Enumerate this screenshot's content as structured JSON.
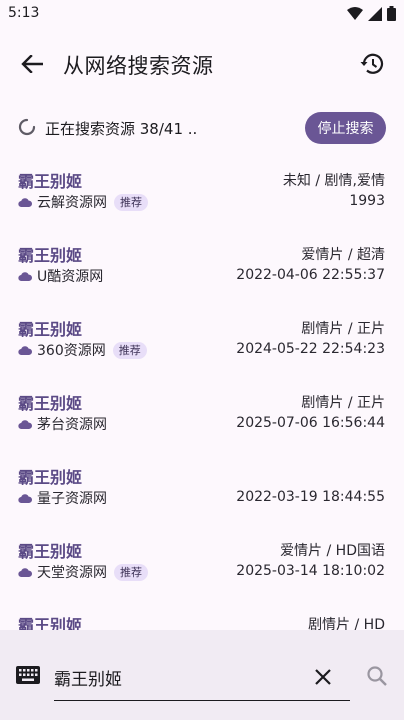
{
  "status_bar": {
    "time": "5:13"
  },
  "app_bar": {
    "title": "从网络搜索资源"
  },
  "progress": {
    "text": "正在搜索资源 38/41 ..",
    "stop_label": "停止搜索"
  },
  "results": [
    {
      "title": "霸王别姬",
      "meta": "未知 / 剧情,爱情",
      "source": "云解资源网",
      "badge": "推荐",
      "date": "1993"
    },
    {
      "title": "霸王别姬",
      "meta": "爱情片 / 超清",
      "source": "U酷资源网",
      "badge": "",
      "date": "2022-04-06 22:55:37"
    },
    {
      "title": "霸王别姬",
      "meta": "剧情片 / 正片",
      "source": "360资源网",
      "badge": "推荐",
      "date": "2024-05-22 22:54:23"
    },
    {
      "title": "霸王别姬",
      "meta": "剧情片 / 正片",
      "source": "茅台资源网",
      "badge": "",
      "date": "2025-07-06 16:56:44"
    },
    {
      "title": "霸王别姬",
      "meta": "",
      "source": "量子资源网",
      "badge": "",
      "date": "2022-03-19 18:44:55"
    },
    {
      "title": "霸王别姬",
      "meta": "爱情片 / HD国语",
      "source": "天堂资源网",
      "badge": "推荐",
      "date": "2025-03-14 18:10:02"
    },
    {
      "title": "霸王别姬",
      "meta": "剧情片 / HD",
      "source": "",
      "badge": "",
      "date": ""
    }
  ],
  "search": {
    "value": "霸王别姬"
  },
  "colors": {
    "accent": "#6a5695",
    "title": "#5b4a86",
    "badge_bg": "#e8def8",
    "background": "#fdf8fd"
  }
}
